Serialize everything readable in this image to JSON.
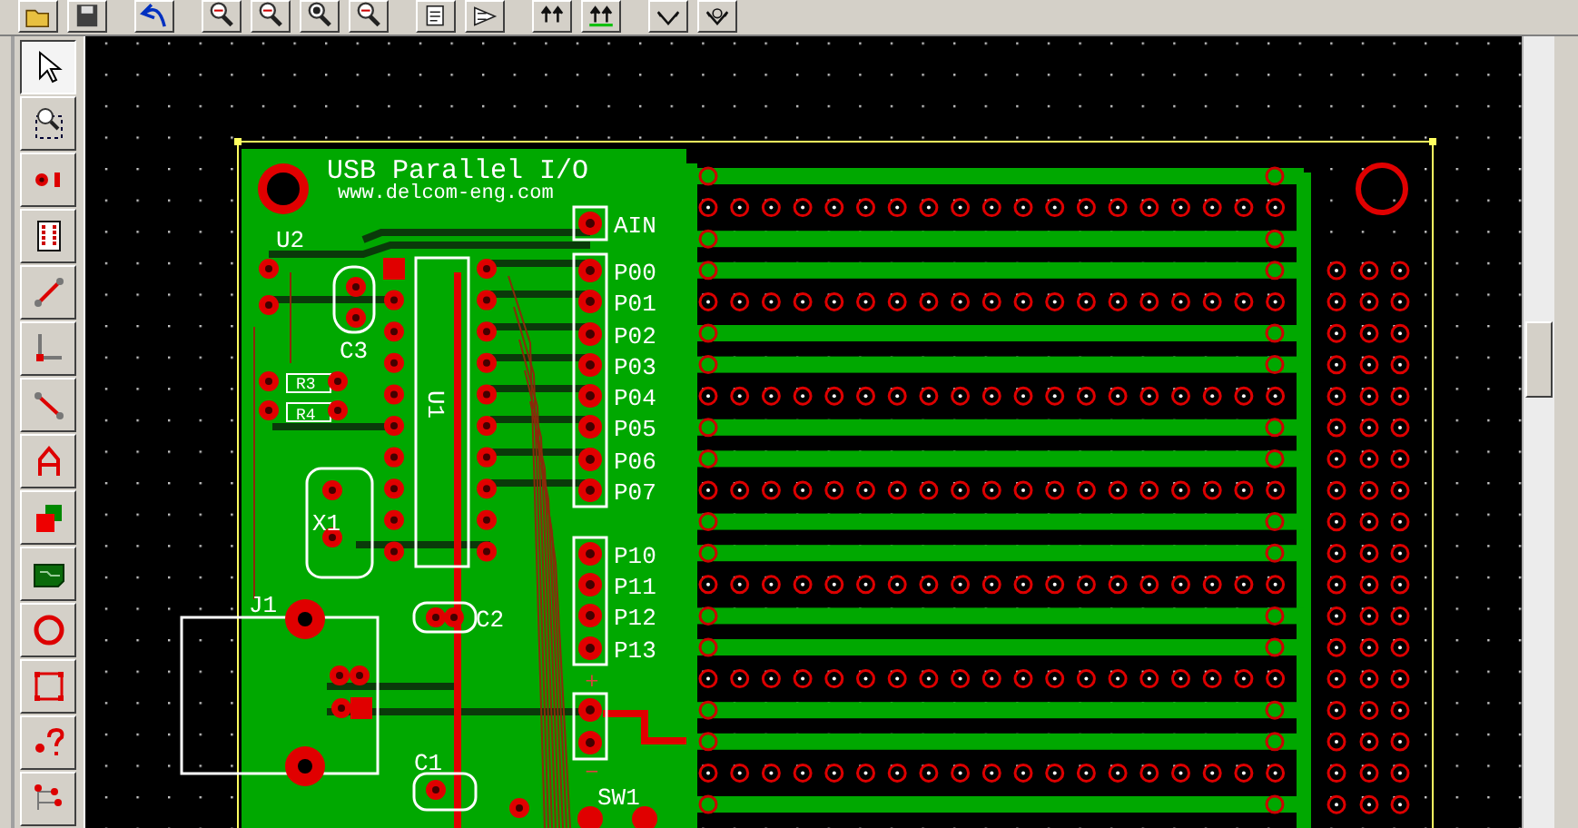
{
  "toolbar": [
    {
      "kind": "open"
    },
    {
      "kind": "save"
    },
    {
      "kind": "undo"
    },
    {
      "kind": "zoom-in"
    },
    {
      "kind": "zoom-out"
    },
    {
      "kind": "zoom-fit"
    },
    {
      "kind": "zoom-redraw"
    },
    {
      "kind": "document"
    },
    {
      "kind": "schematic"
    },
    {
      "kind": "arrows-up"
    },
    {
      "kind": "arrows-ground"
    },
    {
      "kind": "move"
    },
    {
      "kind": "move-text"
    }
  ],
  "tools": [
    {
      "kind": "pointer",
      "selected": true
    },
    {
      "kind": "zoom-window",
      "selected": false
    },
    {
      "kind": "pad",
      "selected": false
    },
    {
      "kind": "footprint",
      "selected": false
    },
    {
      "kind": "trace",
      "selected": false
    },
    {
      "kind": "corner",
      "selected": false
    },
    {
      "kind": "line",
      "selected": false
    },
    {
      "kind": "text",
      "selected": false
    },
    {
      "kind": "layers",
      "selected": false
    },
    {
      "kind": "board",
      "selected": false
    },
    {
      "kind": "circle",
      "selected": false
    },
    {
      "kind": "rectangle",
      "selected": false
    },
    {
      "kind": "query",
      "selected": false
    },
    {
      "kind": "netlist",
      "selected": false
    }
  ],
  "board": {
    "title": "USB Parallel I/O",
    "url": "www.delcom-eng.com",
    "pin_labels": [
      "AIN",
      "P00",
      "P01",
      "P02",
      "P03",
      "P04",
      "P05",
      "P06",
      "P07",
      "P10",
      "P11",
      "P12",
      "P13"
    ],
    "component_labels": [
      "U2",
      "C3",
      "R3",
      "R4",
      "X1",
      "U1",
      "C2",
      "J1",
      "C1",
      "SW1"
    ],
    "polarity_marks": [
      "+",
      "−"
    ]
  }
}
